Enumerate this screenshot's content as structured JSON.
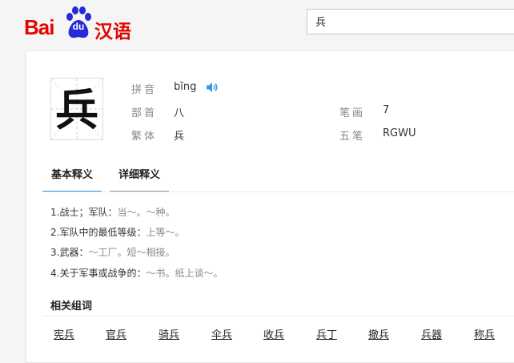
{
  "logo": {
    "bai": "Bai",
    "du": "du",
    "hanyu": "汉语"
  },
  "search": {
    "value": "兵"
  },
  "entry": {
    "character": "兵",
    "pinyin_label": "拼音",
    "pinyin": "bīng",
    "bushou_label": "部首",
    "bushou": "八",
    "bihua_label": "笔画",
    "bihua": "7",
    "fanti_label": "繁体",
    "fanti": "兵",
    "wubi_label": "五笔",
    "wubi": "RGWU"
  },
  "tabs": {
    "basic": "基本释义",
    "detail": "详细释义"
  },
  "definitions": [
    {
      "text": "1.战士；军队：",
      "example": "当～。～种。"
    },
    {
      "text": "2.军队中的最低等级：",
      "example": "上等～。"
    },
    {
      "text": "3.武器：",
      "example": "～工厂。短～相接。"
    },
    {
      "text": "4.关于军事或战争的：",
      "example": "～书。纸上谈～。"
    }
  ],
  "related": {
    "title": "相关组词",
    "words": [
      "宪兵",
      "官兵",
      "骑兵",
      "伞兵",
      "收兵",
      "兵丁",
      "撤兵",
      "兵器",
      "称兵"
    ]
  },
  "colors": {
    "brand_red": "#e10601",
    "brand_blue": "#2529d8",
    "tab_accent": "#2f8fe0"
  }
}
